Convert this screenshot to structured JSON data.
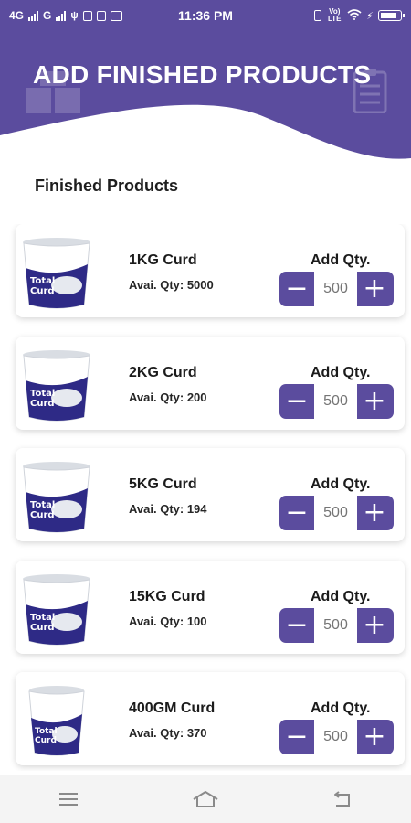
{
  "status_bar": {
    "network_1": "4G",
    "network_2": "G",
    "time": "11:36 PM",
    "volte": "Vo) LTE",
    "icons": [
      "signal-icon",
      "usb-icon",
      "nfc-icon",
      "notification-icon",
      "youtube-icon",
      "vibrate-icon",
      "wifi-icon",
      "charging-icon",
      "battery-icon"
    ]
  },
  "header": {
    "title": "ADD FINISHED PRODUCTS",
    "accent_color": "#5b4c9e",
    "icons": [
      "boxes-icon",
      "clipboard-icon"
    ]
  },
  "section": {
    "title": "Finished Products"
  },
  "products": [
    {
      "name": "1KG Curd",
      "availability": "Avai. Qty: 5000",
      "qty_label": "Add Qty.",
      "qty_placeholder": "500",
      "minus": "−",
      "plus": "+"
    },
    {
      "name": "2KG Curd",
      "availability": "Avai. Qty: 200",
      "qty_label": "Add Qty.",
      "qty_placeholder": "500",
      "minus": "−",
      "plus": "+"
    },
    {
      "name": "5KG Curd",
      "availability": "Avai. Qty: 194",
      "qty_label": "Add Qty.",
      "qty_placeholder": "500",
      "minus": "−",
      "plus": "+"
    },
    {
      "name": "15KG Curd",
      "availability": "Avai. Qty: 100",
      "qty_label": "Add Qty.",
      "qty_placeholder": "500",
      "minus": "−",
      "plus": "+"
    },
    {
      "name": "400GM Curd",
      "availability": "Avai. Qty: 370",
      "qty_label": "Add Qty.",
      "qty_placeholder": "500",
      "minus": "−",
      "plus": "+"
    }
  ],
  "navigation": {
    "icons": [
      "menu-icon",
      "home-icon",
      "back-icon"
    ]
  }
}
